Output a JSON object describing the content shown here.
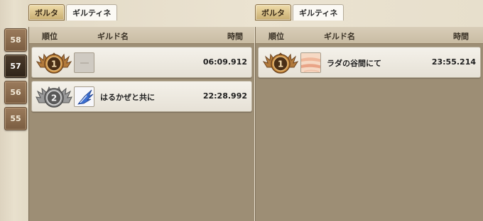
{
  "weeks": [
    "58",
    "57",
    "56",
    "55"
  ],
  "active_week": "57",
  "left_panel": {
    "tabs": [
      {
        "label": "ボルタ",
        "selected": true
      },
      {
        "label": "ギルティネ",
        "selected": false
      }
    ],
    "columns": {
      "rank": "順位",
      "guild": "ギルド名",
      "time": "時間"
    },
    "rows": [
      {
        "rank": "1",
        "medal": "gold",
        "guild_icon": "blank-emblem-icon",
        "guild_name": "",
        "time": "06:09.912"
      },
      {
        "rank": "2",
        "medal": "silver",
        "guild_icon": "blue-wing-emblem-icon",
        "guild_name": "はるかぜと共に",
        "time": "22:28.992"
      }
    ]
  },
  "right_panel": {
    "tabs": [
      {
        "label": "ボルタ",
        "selected": true
      },
      {
        "label": "ギルティネ",
        "selected": false
      }
    ],
    "columns": {
      "rank": "順位",
      "guild": "ギルド名",
      "time": "時間"
    },
    "rows": [
      {
        "rank": "1",
        "medal": "gold",
        "guild_icon": "peach-stripe-emblem-icon",
        "guild_name": "ラダの谷間にて",
        "time": "23:55.214"
      }
    ]
  },
  "colors": {
    "gold_medal": "#c98a3a",
    "silver_medal": "#8a8a8a",
    "active_week_bg": "#2f2418",
    "table_bg": "#9d8e75"
  }
}
